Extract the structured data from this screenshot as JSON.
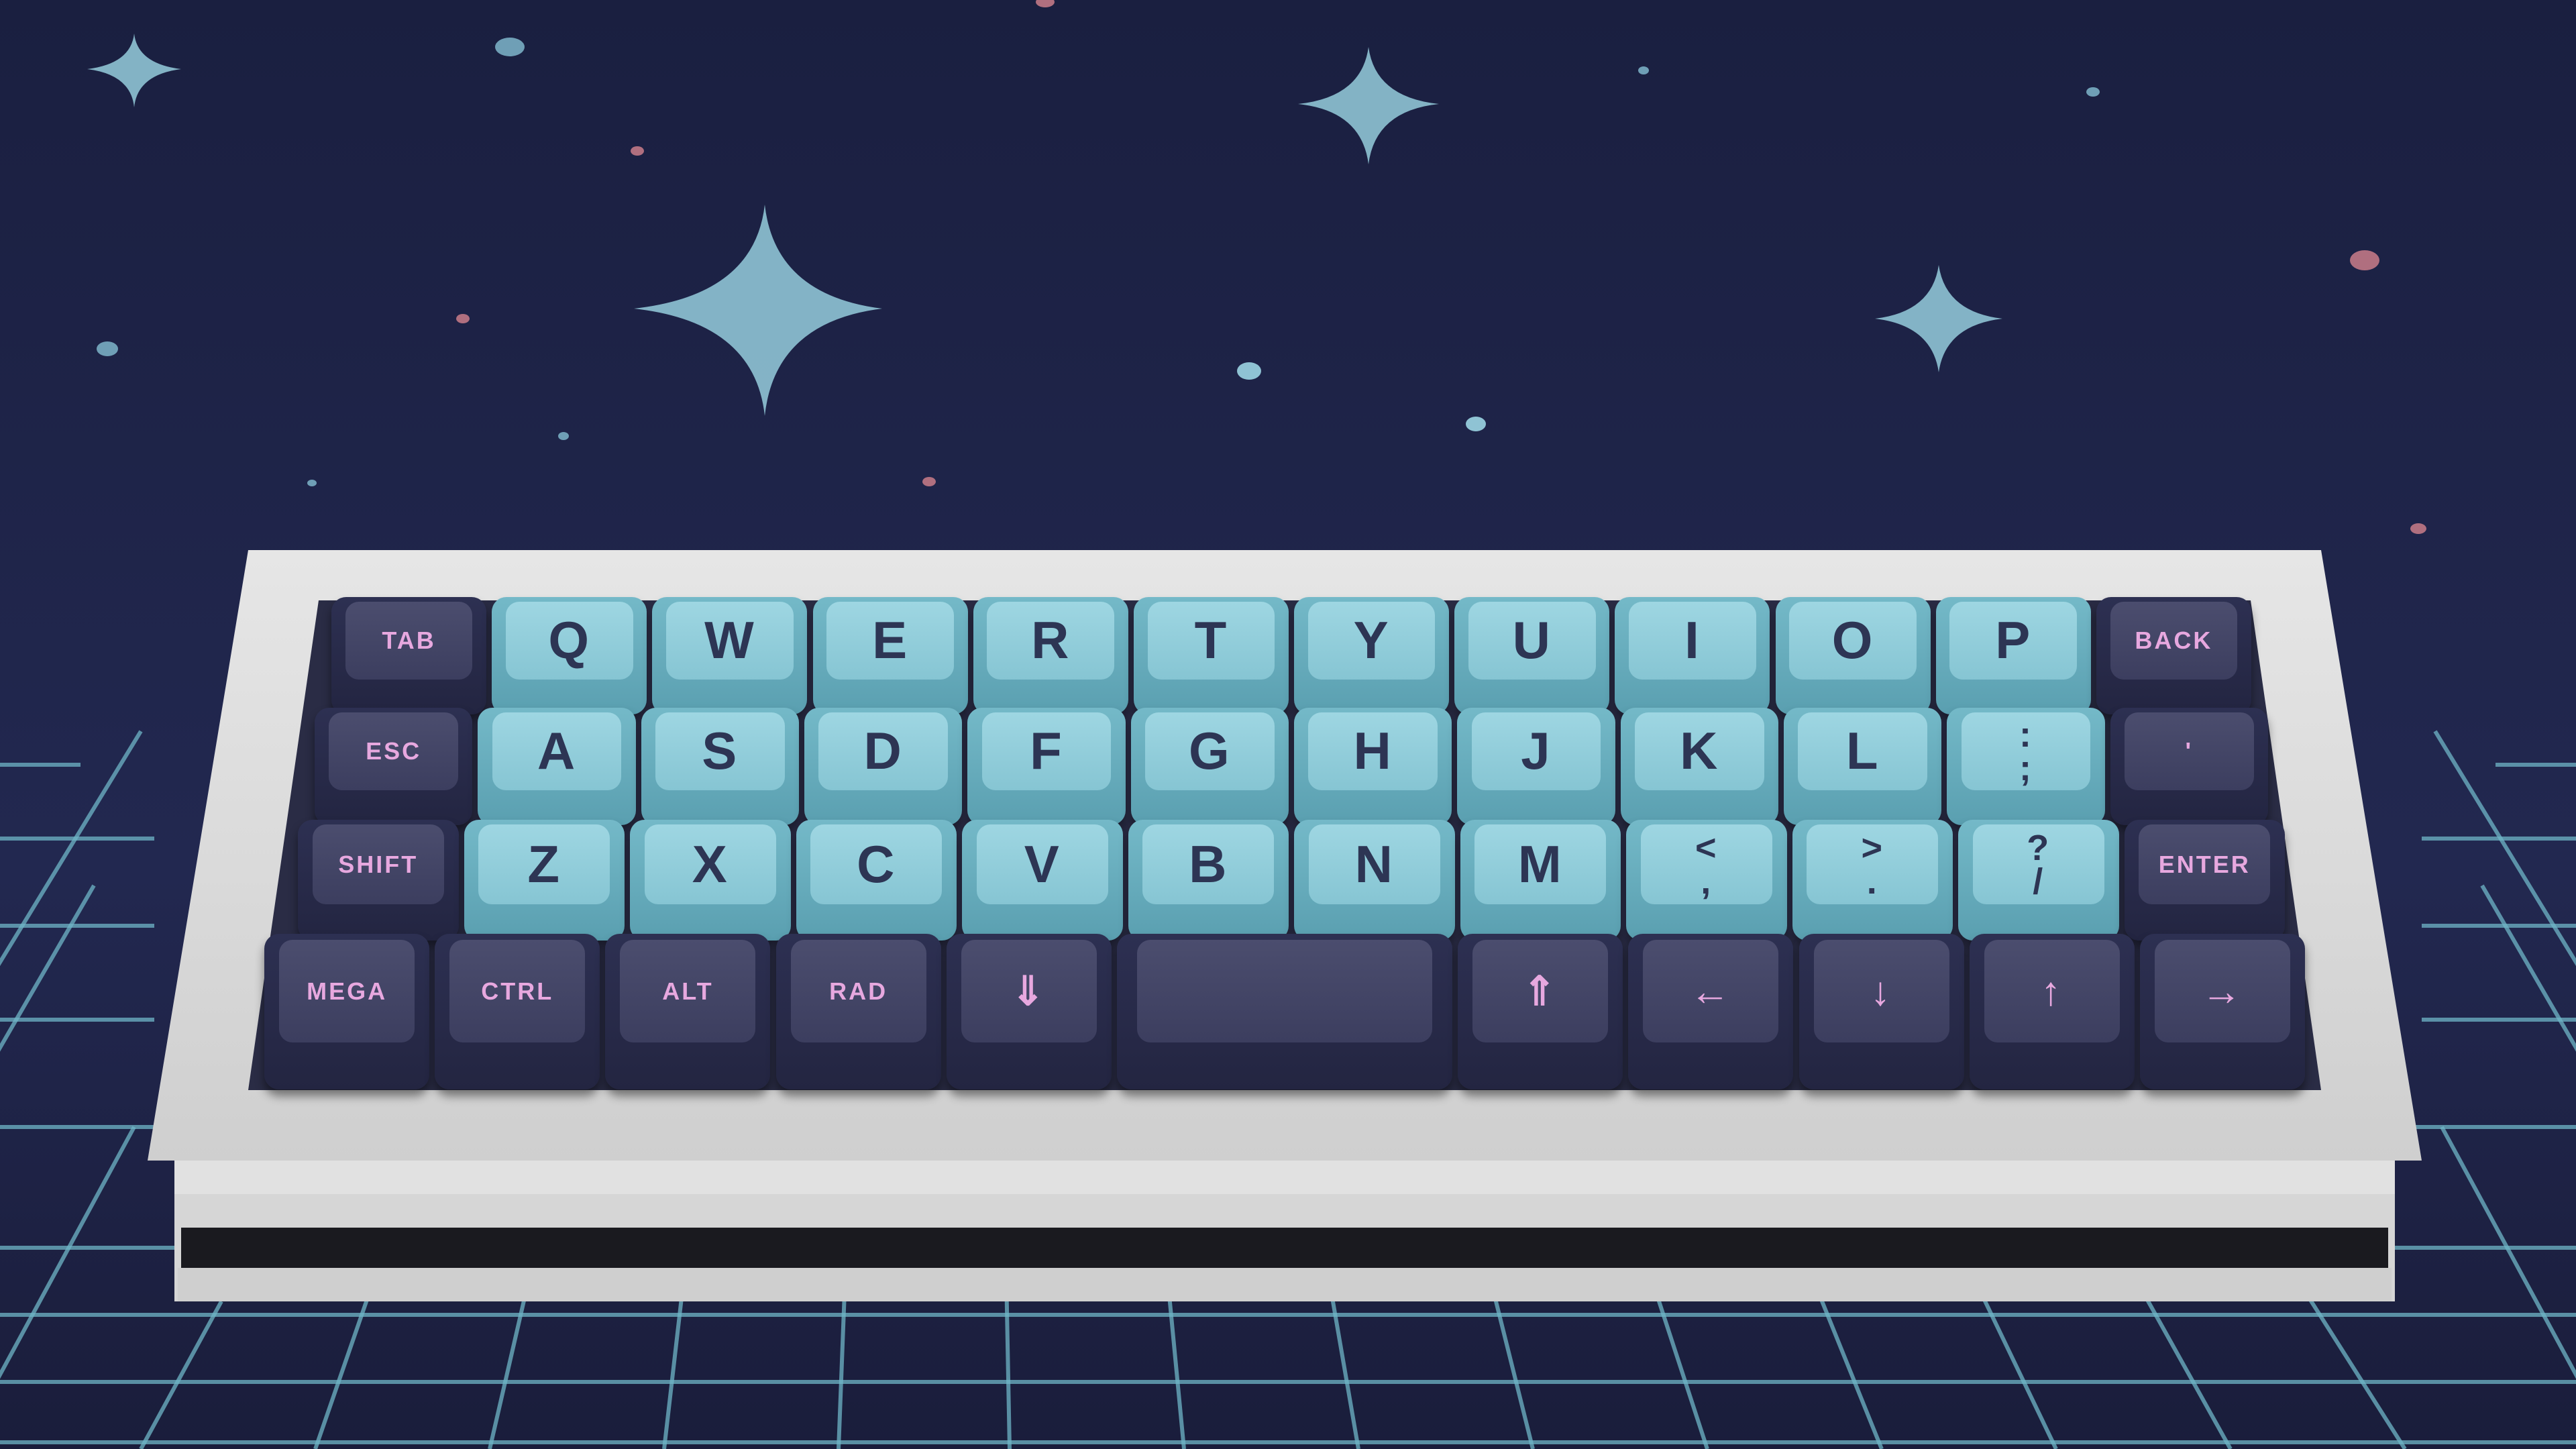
{
  "scene": {
    "description_colors": {
      "sky": "#1d2244",
      "grid_line": "#6fb6c7",
      "case": "#d9d9d9",
      "alpha_cap": "#9ed6e2",
      "mod_cap": "#3f4163",
      "mod_legend": "#e7a8df",
      "alpha_legend": "#2d3554"
    }
  },
  "keyboard": {
    "rows": [
      [
        {
          "label": "TAB",
          "type": "mod"
        },
        {
          "label": "Q",
          "type": "alpha"
        },
        {
          "label": "W",
          "type": "alpha"
        },
        {
          "label": "E",
          "type": "alpha"
        },
        {
          "label": "R",
          "type": "alpha"
        },
        {
          "label": "T",
          "type": "alpha"
        },
        {
          "label": "Y",
          "type": "alpha"
        },
        {
          "label": "U",
          "type": "alpha"
        },
        {
          "label": "I",
          "type": "alpha"
        },
        {
          "label": "O",
          "type": "alpha"
        },
        {
          "label": "P",
          "type": "alpha"
        },
        {
          "label": "BACK",
          "type": "mod"
        }
      ],
      [
        {
          "label": "ESC",
          "type": "mod"
        },
        {
          "label": "A",
          "type": "alpha"
        },
        {
          "label": "S",
          "type": "alpha"
        },
        {
          "label": "D",
          "type": "alpha"
        },
        {
          "label": "F",
          "type": "alpha"
        },
        {
          "label": "G",
          "type": "alpha"
        },
        {
          "label": "H",
          "type": "alpha"
        },
        {
          "label": "J",
          "type": "alpha"
        },
        {
          "label": "K",
          "type": "alpha"
        },
        {
          "label": "L",
          "type": "alpha"
        },
        {
          "label": ":",
          "sub": ";",
          "type": "alpha"
        },
        {
          "label": "'",
          "type": "mod"
        }
      ],
      [
        {
          "label": "SHIFT",
          "type": "mod"
        },
        {
          "label": "Z",
          "type": "alpha"
        },
        {
          "label": "X",
          "type": "alpha"
        },
        {
          "label": "C",
          "type": "alpha"
        },
        {
          "label": "V",
          "type": "alpha"
        },
        {
          "label": "B",
          "type": "alpha"
        },
        {
          "label": "N",
          "type": "alpha"
        },
        {
          "label": "M",
          "type": "alpha"
        },
        {
          "label": "<",
          "sub": ",",
          "type": "alpha"
        },
        {
          "label": ">",
          "sub": ".",
          "type": "alpha"
        },
        {
          "label": "?",
          "sub": "/",
          "type": "alpha"
        },
        {
          "label": "ENTER",
          "type": "mod"
        }
      ],
      [
        {
          "label": "MEGA",
          "type": "mod"
        },
        {
          "label": "CTRL",
          "type": "mod"
        },
        {
          "label": "ALT",
          "type": "mod"
        },
        {
          "label": "RAD",
          "type": "mod"
        },
        {
          "label": "⇓",
          "type": "mod",
          "arrow": true
        },
        {
          "label": "",
          "type": "mod",
          "space": true
        },
        {
          "label": "⇑",
          "type": "mod",
          "arrow": true
        },
        {
          "label": "←",
          "type": "mod",
          "arrow": true
        },
        {
          "label": "↓",
          "type": "mod",
          "arrow": true
        },
        {
          "label": "↑",
          "type": "mod",
          "arrow": true
        },
        {
          "label": "→",
          "type": "mod",
          "arrow": true
        }
      ]
    ]
  }
}
